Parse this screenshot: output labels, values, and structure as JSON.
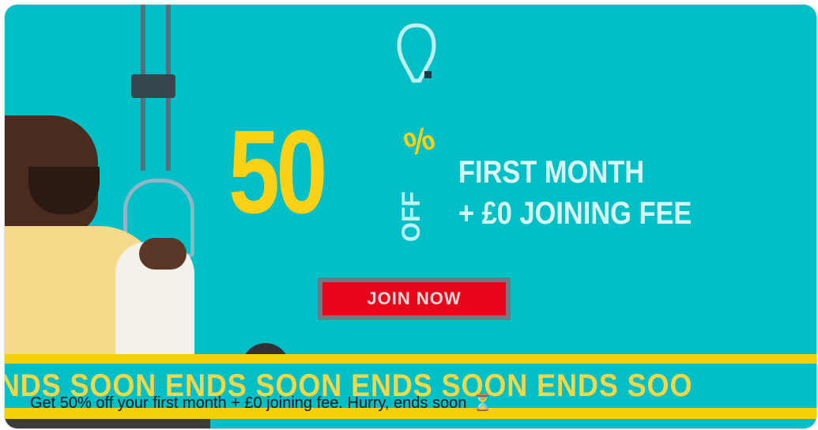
{
  "ad": {
    "headline_number": "50",
    "percent_sign": "%",
    "off_label": "OFF",
    "offer_line_1": "FIRST MONTH",
    "offer_line_2": "+ £0 JOINING FEE",
    "cta_label": "JOIN NOW",
    "ticker_text": "ENDS SOON ENDS SOON ENDS SOON ENDS SOO"
  },
  "caption": {
    "text": "Get 50% off your first month + £0 joining fee. Hurry, ends soon",
    "emoji": "⏳"
  },
  "colors": {
    "background": "#00bfc6",
    "accent_yellow": "#fcd116",
    "cta_red": "#e8051a"
  }
}
